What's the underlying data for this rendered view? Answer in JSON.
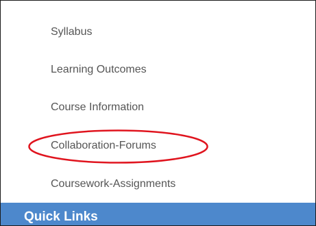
{
  "nav": {
    "items": [
      {
        "label": "Syllabus"
      },
      {
        "label": "Learning Outcomes"
      },
      {
        "label": "Course Information"
      },
      {
        "label": "Collaboration-Forums"
      },
      {
        "label": "Coursework-Assignments"
      }
    ]
  },
  "quick_links": {
    "label": "Quick Links"
  },
  "colors": {
    "text": "#555555",
    "highlight_circle": "#e0141e",
    "quick_links_bg": "#4d88cc",
    "quick_links_text": "#ffffff",
    "border": "#1a1a1a"
  },
  "annotation": {
    "type": "red-ellipse",
    "target": "Collaboration-Forums"
  }
}
